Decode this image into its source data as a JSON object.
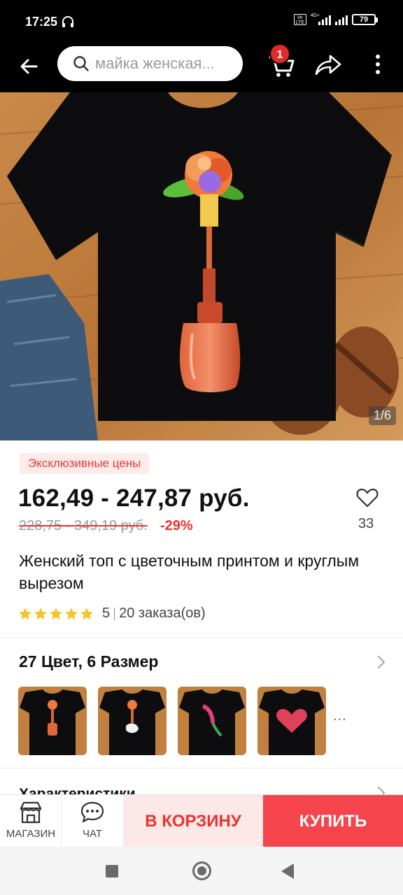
{
  "status_bar": {
    "time": "17:25",
    "volte": "Vo LTE",
    "network": "4G+",
    "battery": "79"
  },
  "top_nav": {
    "search_placeholder": "майка женская...",
    "cart_badge": "1"
  },
  "product": {
    "image_counter": "1/6",
    "badge": "Эксклюзивные цены",
    "price": "162,49 - 247,87 руб.",
    "old_price": "228,75 - 349,19 руб.",
    "discount": "-29%",
    "wishlist_count": "33",
    "title": "Женский топ с цветочным принтом и круглым вырезом",
    "rating": "5",
    "orders": "20 заказа(ов)"
  },
  "variants": {
    "title": "27 Цвет, 6 Размер",
    "more": "..."
  },
  "specs": {
    "title": "Характеристики"
  },
  "action_bar": {
    "store_label": "МАГАЗИН",
    "chat_label": "ЧАТ",
    "cart_button": "В КОРЗИНУ",
    "buy_button": "КУПИТЬ"
  },
  "colors": {
    "accent_red": "#f5444b",
    "price_red": "#e8342e",
    "badge_bg": "#fdebea",
    "star": "#f7c325"
  },
  "icons": [
    "headset-icon",
    "back-arrow-icon",
    "search-icon",
    "cart-icon",
    "share-icon",
    "more-vertical-icon",
    "heart-icon",
    "star-icon",
    "chevron-right-icon",
    "store-icon",
    "chat-icon"
  ]
}
